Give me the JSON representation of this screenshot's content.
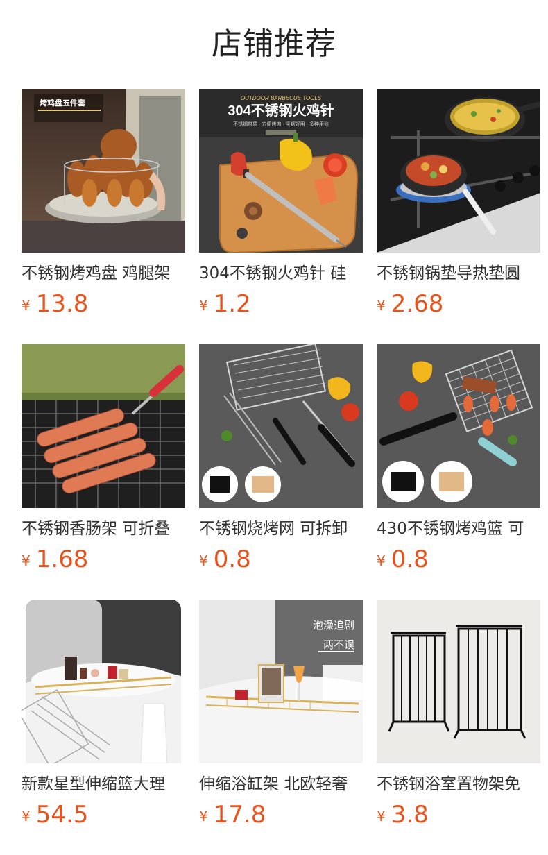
{
  "header": {
    "title": "店铺推荐"
  },
  "colors": {
    "price": "#e8521b",
    "title": "#222222",
    "name": "#333333"
  },
  "products": [
    {
      "name": "不锈钢烤鸡盘 鸡腿架",
      "currency": "¥",
      "price": "13.8",
      "image_icon": "chicken-roaster-photo",
      "image_banner": "烤鸡盘五件套"
    },
    {
      "name": "304不锈钢火鸡针 硅",
      "currency": "¥",
      "price": "1.2",
      "image_icon": "turkey-baster-photo",
      "image_banner": "304不锈钢火鸡针",
      "image_banner_top": "OUTDOOR BARBECUE TOOLS",
      "image_banner_sub": "不锈钢材质 · 方便烤肉 · 坚韧好用 · 多种用途"
    },
    {
      "name": "不锈钢锅垫导热垫圆",
      "currency": "¥",
      "price": "2.68",
      "image_icon": "stove-heat-diffuser-photo"
    },
    {
      "name": "不锈钢香肠架 可折叠",
      "currency": "¥",
      "price": "1.68",
      "image_icon": "sausage-rack-photo"
    },
    {
      "name": "不锈钢烧烤网 可拆卸",
      "currency": "¥",
      "price": "0.8",
      "image_icon": "grill-basket-photo"
    },
    {
      "name": "430不锈钢烤鸡篮 可",
      "currency": "¥",
      "price": "0.8",
      "image_icon": "grill-basket-2-photo"
    },
    {
      "name": "新款星型伸缩篮大理",
      "currency": "¥",
      "price": "54.5",
      "image_icon": "bathtub-caddy-photo"
    },
    {
      "name": "伸缩浴缸架 北欧轻奢",
      "currency": "¥",
      "price": "17.8",
      "image_icon": "bathtub-tray-photo",
      "image_banner": "泡澡追剧",
      "image_banner_sub": "两不误"
    },
    {
      "name": "不锈钢浴室置物架免",
      "currency": "¥",
      "price": "3.8",
      "image_icon": "bathroom-shelf-photo"
    }
  ]
}
